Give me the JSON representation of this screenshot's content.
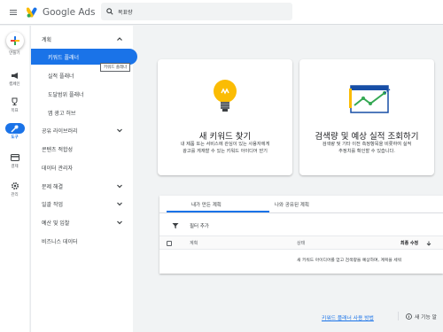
{
  "app": {
    "name": "Google Ads"
  },
  "search": {
    "text": "목표량"
  },
  "rail": [
    {
      "label": "만들기",
      "icon": "plus-icon"
    },
    {
      "label": "캠페인",
      "icon": "megaphone-icon"
    },
    {
      "label": "목표",
      "icon": "trophy-icon"
    },
    {
      "label": "도구",
      "icon": "tools-icon"
    },
    {
      "label": "결제",
      "icon": "credit-card-icon"
    },
    {
      "label": "관리",
      "icon": "gear-icon"
    }
  ],
  "menu": {
    "planning": "계획",
    "keyword_planner": "키워드 플래너",
    "performance_planner": "실적 플래너",
    "reach_planner": "도달범위 플래너",
    "app_ad_hub": "앱 광고 허브",
    "shared_library": "공유 라이브러리",
    "content_suitability": "콘텐츠 적합성",
    "data_manager": "데이터 관리자",
    "troubleshooting": "문제 해결",
    "bulk_actions": "일괄 작업",
    "budgets_bids": "예산 및 입찰",
    "business_data": "비즈니스 데이터",
    "tooltip": "키워드 플래너"
  },
  "cards": {
    "discover": {
      "title": "새 키워드 찾기",
      "desc1": "내 제품 또는 서비스에 관심이 있는 사용자에게",
      "desc2": "광고를 게재할 수 있는 키워드 아이디어 얻기"
    },
    "forecast": {
      "title": "검색량 및 예상 실적 조회하기",
      "desc1": "검색량 및 기타 이전 측정항목을 비롯하여 실적",
      "desc2": "추정치를 확인할 수 있습니다."
    }
  },
  "plans": {
    "tab_mine": "내가 만든 계획",
    "tab_shared": "나와 공유된 계획",
    "add_filter": "필터 추가",
    "col_plan": "계획",
    "col_status": "상태",
    "col_modified": "최종 수정",
    "empty_text": "새 키워드 아이디어를 얻고 검색량을 예상하며, 계획을 세워"
  },
  "footer": {
    "how_to_use": "키워드 플래너 사용 방법",
    "new_features": "새 기능 알"
  },
  "colors": {
    "accent": "#1a73e8",
    "blue_dark": "#174ea6",
    "yellow": "#fbbc04",
    "green": "#34a853",
    "red": "#ea4335"
  }
}
